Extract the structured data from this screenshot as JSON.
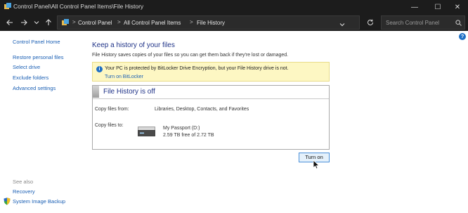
{
  "window": {
    "title": "Control Panel\\All Control Panel Items\\File History",
    "controls": {
      "minimize": "—",
      "maximize": "☐",
      "close": "✕"
    }
  },
  "nav": {
    "back": "←",
    "forward": "→",
    "history": "⌄",
    "up": "↑",
    "refresh": "↻",
    "history_dropdown": "⌄",
    "breadcrumb": [
      "Control Panel",
      "All Control Panel Items",
      "File History"
    ],
    "breadcrumb_separator": ">",
    "search_placeholder": "Search Control Panel"
  },
  "help": "?",
  "sidebar": {
    "home": "Control Panel Home",
    "items": [
      "Restore personal files",
      "Select drive",
      "Exclude folders",
      "Advanced settings"
    ],
    "see_also_label": "See also",
    "see_also": [
      "Recovery",
      "System Image Backup"
    ]
  },
  "main": {
    "heading": "Keep a history of your files",
    "subtitle": "File History saves copies of your files so you can get them back if they're lost or damaged.",
    "info": {
      "icon": "i",
      "text": "Your PC is protected by BitLocker Drive Encryption, but your File History drive is not.",
      "link": "Turn on BitLocker"
    },
    "panel": {
      "status": "File History is off",
      "copy_from_label": "Copy files from:",
      "copy_from_value": "Libraries, Desktop, Contacts, and Favorites",
      "copy_to_label": "Copy files to:",
      "drive_name": "My Passport (D:)",
      "drive_space": "2.59 TB free of 2.72 TB"
    },
    "turn_on_button": "Turn on"
  },
  "colors": {
    "titlebar": "#1c1c1c",
    "link": "#1a5fb4",
    "heading": "#1e3287",
    "infobar": "#fdf7c3"
  }
}
